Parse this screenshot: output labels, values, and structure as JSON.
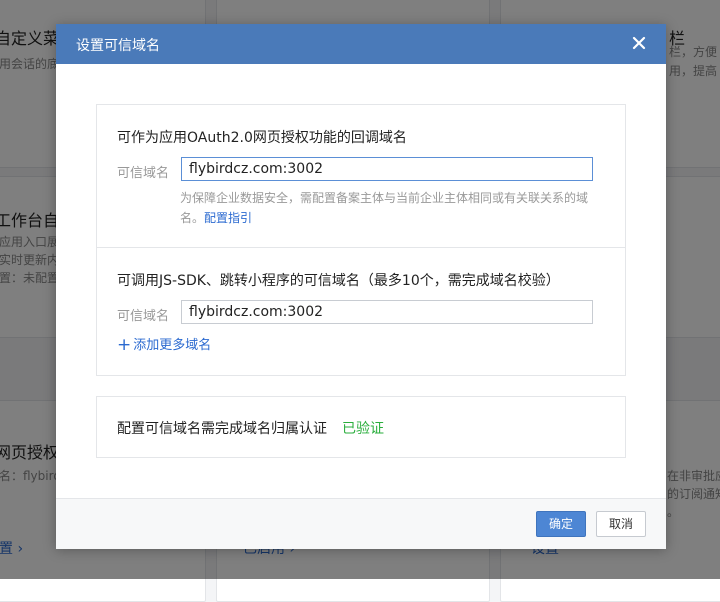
{
  "background": {
    "cards": [
      {
        "title": "自定义菜单",
        "lines": [
          "用会话的底"
        ]
      },
      {
        "title": "栏",
        "lines": [
          "栏，方便",
          "用，提高"
        ]
      },
      {
        "title": "工作台自定",
        "lines": [
          "应用入口展",
          "实时更新内",
          "置：未配置"
        ]
      },
      {
        "title": "网页授权及",
        "lines": [
          "名：flybird"
        ],
        "link": "置 ›"
      },
      {
        "title": "",
        "lines": [],
        "link": "已启用 ›"
      },
      {
        "title": "",
        "lines": [
          "在非审批应",
          "的订阅通知",
          "。"
        ],
        "link": "设置"
      }
    ]
  },
  "dialog": {
    "title": "设置可信域名",
    "section_oauth": {
      "title": "可作为应用OAuth2.0网页授权功能的回调域名",
      "label": "可信域名",
      "value": "flybirdcz.com:3002",
      "hint": "为保障企业数据安全，需配置备案主体与当前企业主体相同或有关联关系的域名。",
      "hint_link": "配置指引"
    },
    "section_jssdk": {
      "title": "可调用JS-SDK、跳转小程序的可信域名（最多10个，需完成域名校验）",
      "label": "可信域名",
      "value": "flybirdcz.com:3002",
      "add_more": "添加更多域名"
    },
    "verify": {
      "text": "配置可信域名需完成域名归属认证",
      "status": "已验证"
    },
    "footer": {
      "confirm": "确定",
      "cancel": "取消"
    }
  },
  "colors": {
    "header": "#4a7ab9",
    "primary_button": "#4d86d4",
    "link": "#2b6ad0",
    "verified": "#2aae3c"
  }
}
